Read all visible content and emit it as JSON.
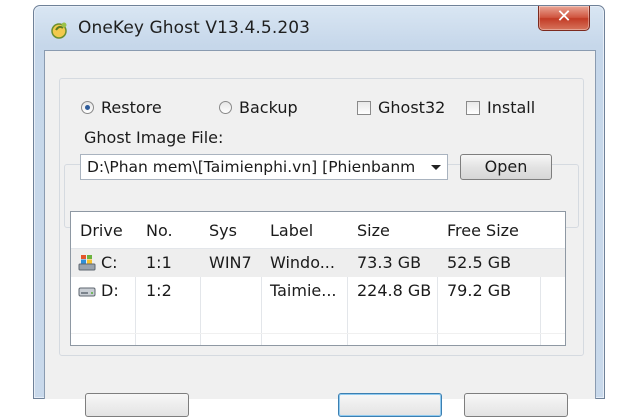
{
  "window": {
    "title": "OneKey Ghost V13.4.5.203",
    "close_glyph": "✕"
  },
  "options": {
    "restore_label": "Restore",
    "restore_checked": true,
    "backup_label": "Backup",
    "backup_checked": false,
    "ghost32_label": "Ghost32",
    "ghost32_checked": false,
    "install_label": "Install",
    "install_checked": false
  },
  "image_file": {
    "label": "Ghost Image File:",
    "path": "D:\\Phan mem\\[Taimienphi.vn] [Phienbanm",
    "open_button": "Open"
  },
  "table": {
    "headers": [
      "Drive",
      "No.",
      "Sys",
      "Label",
      "Size",
      "Free Size"
    ],
    "rows": [
      {
        "icon": "windows-drive-icon",
        "drive": "C:",
        "no": "1:1",
        "sys": "WIN7",
        "label": "Windo...",
        "size": "73.3 GB",
        "free": "52.5 GB"
      },
      {
        "icon": "hard-drive-icon",
        "drive": "D:",
        "no": "1:2",
        "sys": "",
        "label": "Taimie...",
        "size": "224.8 GB",
        "free": "79.2 GB"
      }
    ]
  },
  "colors": {
    "accent": "#2d5b9a",
    "close": "#c23b25",
    "frame": "#c6d7ea"
  }
}
